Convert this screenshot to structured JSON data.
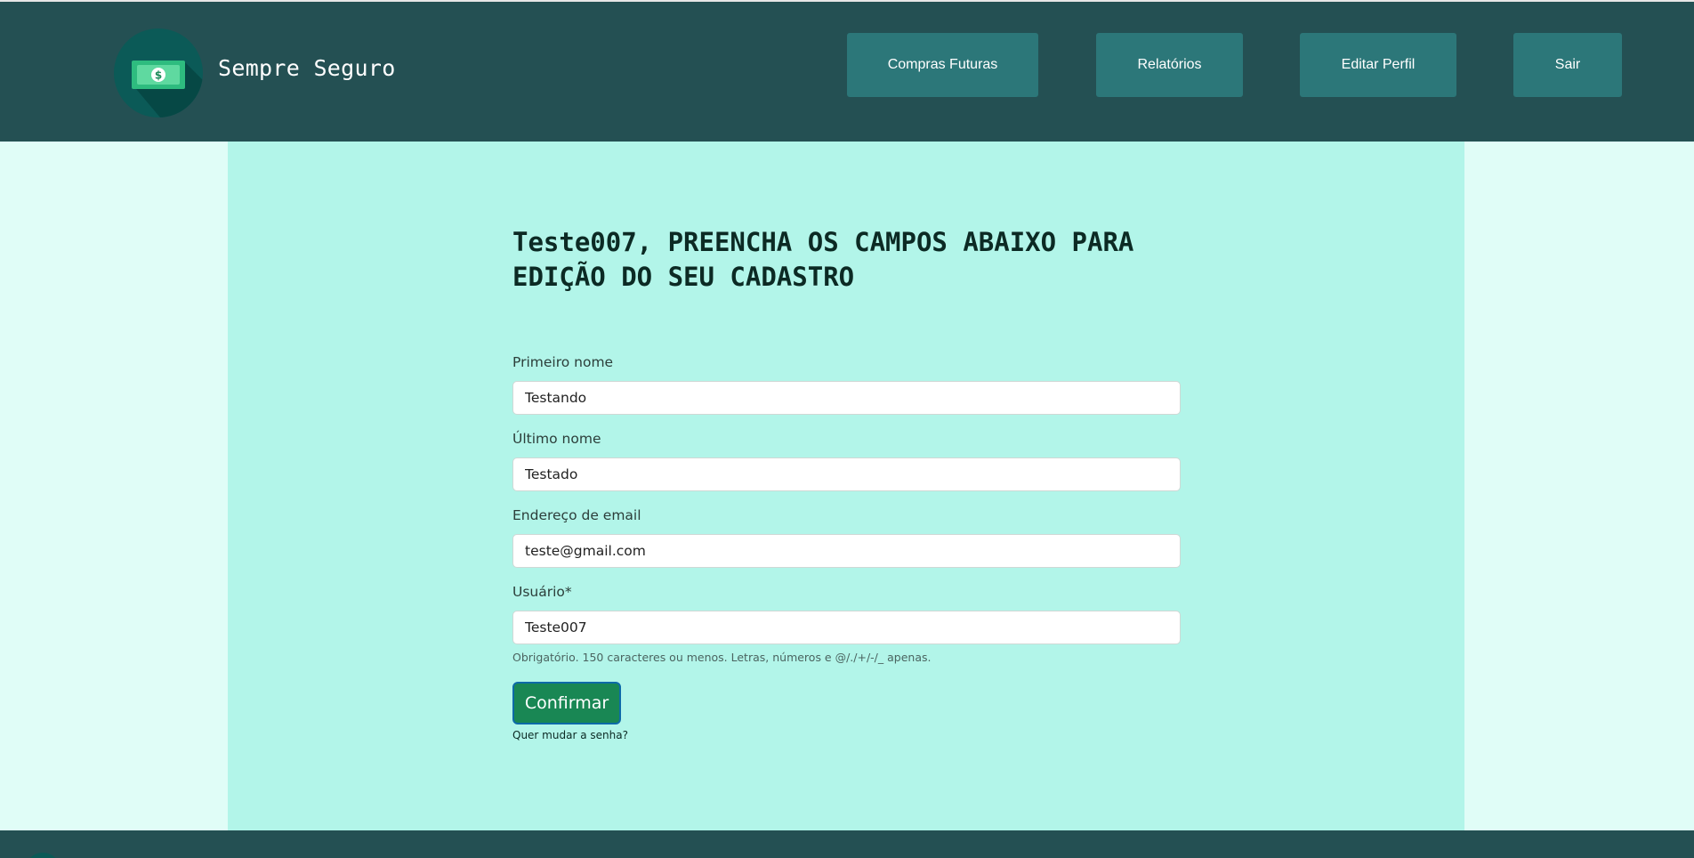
{
  "header": {
    "brand": "Sempre Seguro",
    "logo_icon": "money-bill-icon",
    "nav": [
      {
        "label": "Compras Futuras"
      },
      {
        "label": "Relatórios"
      },
      {
        "label": "Editar Perfil"
      },
      {
        "label": "Sair"
      }
    ]
  },
  "form": {
    "title": "Teste007, PREENCHA OS CAMPOS ABAIXO PARA EDIÇÃO DO SEU CADASTRO",
    "fields": [
      {
        "label": "Primeiro nome",
        "value": "Testando"
      },
      {
        "label": "Último nome",
        "value": "Testado"
      },
      {
        "label": "Endereço de email",
        "value": "teste@gmail.com"
      },
      {
        "label": "Usuário*",
        "value": "Teste007"
      }
    ],
    "help_text": "Obrigatório. 150 caracteres ou menos. Letras, números e @/./+/-/_ apenas.",
    "submit_label": "Confirmar",
    "password_link": "Quer mudar a senha?"
  },
  "colors": {
    "header_bg": "#245053",
    "nav_button": "#2c7779",
    "content_bg": "#b2f5e9",
    "page_bg": "#e0fdf7",
    "submit_bg": "#198754"
  }
}
